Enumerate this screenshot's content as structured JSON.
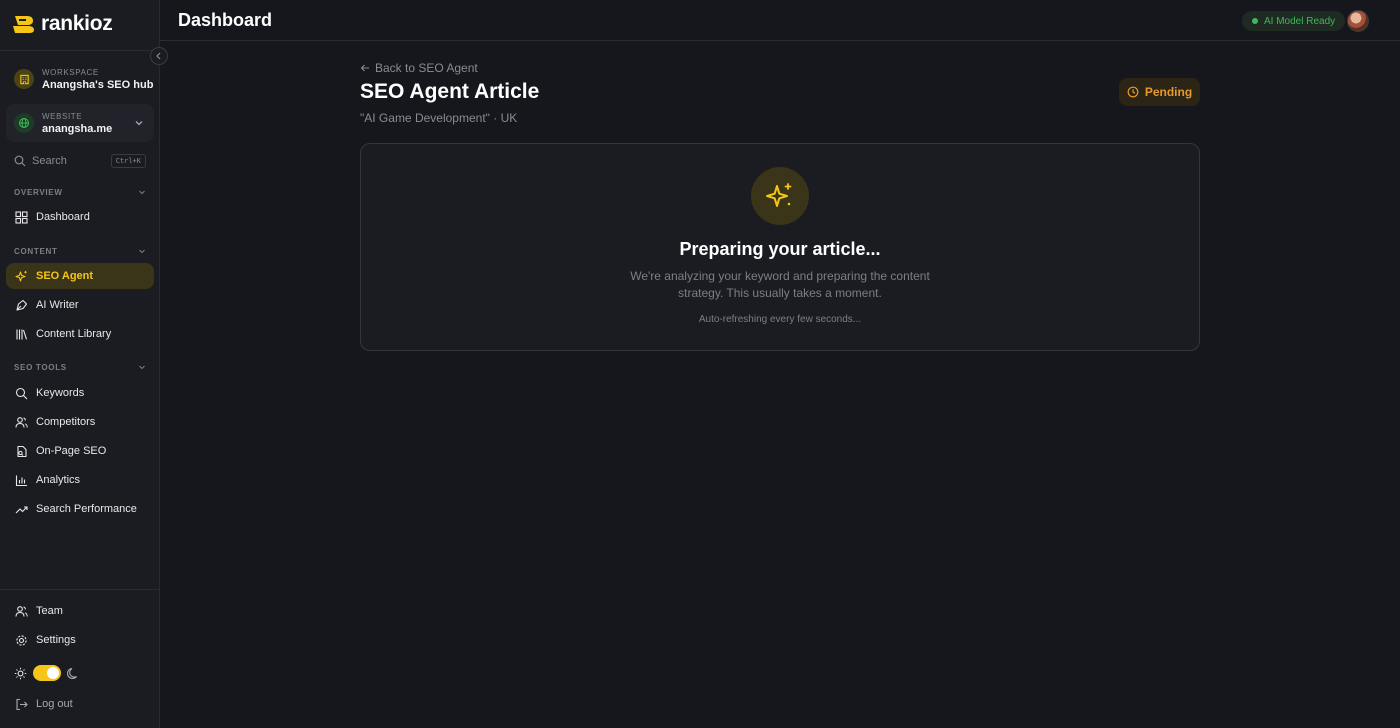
{
  "brand": {
    "name": "rankioz"
  },
  "workspace": {
    "label": "WORKSPACE",
    "value": "Anangsha's SEO hub"
  },
  "website": {
    "label": "WEBSITE",
    "value": "anangsha.me"
  },
  "search": {
    "placeholder": "Search",
    "shortcut": "Ctrl+K"
  },
  "sections": {
    "overview": "OVERVIEW",
    "content": "CONTENT",
    "seo_tools": "SEO TOOLS"
  },
  "nav": {
    "dashboard": "Dashboard",
    "seo_agent": "SEO Agent",
    "ai_writer": "AI Writer",
    "content_library": "Content Library",
    "keywords": "Keywords",
    "competitors": "Competitors",
    "on_page_seo": "On-Page SEO",
    "analytics": "Analytics",
    "search_performance": "Search Performance",
    "team": "Team",
    "settings": "Settings",
    "log_out": "Log out"
  },
  "header": {
    "title": "Dashboard",
    "ai_status": "AI Model Ready"
  },
  "article": {
    "back_label": "Back to SEO Agent",
    "title": "SEO Agent Article",
    "subtitle": "\"AI Game Development\" · UK",
    "status": "Pending"
  },
  "card": {
    "title": "Preparing your article...",
    "description": "We're analyzing your keyword and preparing the content strategy. This usually takes a moment.",
    "note": "Auto-refreshing every few seconds..."
  },
  "theme": {
    "mode": "dark"
  },
  "colors": {
    "accent": "#f5c518",
    "status_ready": "#3fb85c",
    "status_pending": "#e59a2c",
    "background": "#16171c",
    "sidebar": "#1b1c21"
  }
}
